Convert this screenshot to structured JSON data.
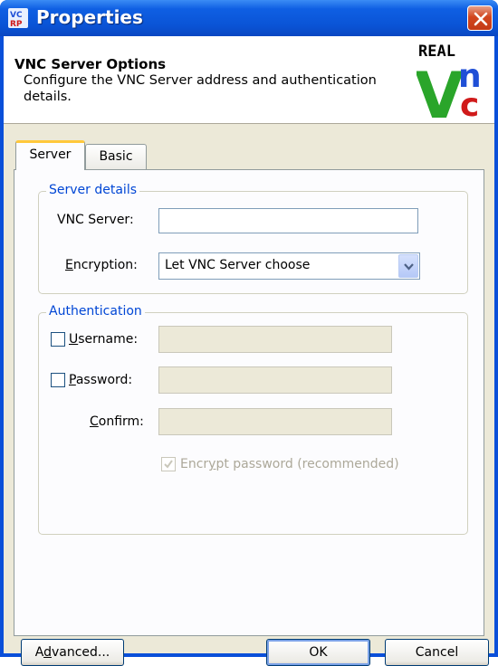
{
  "window": {
    "title": "Properties"
  },
  "header": {
    "title": "VNC Server Options",
    "description": "Configure the VNC Server address and authentication details.",
    "logo_text_top": "REAL",
    "logo_text_v": "V",
    "logo_text_n": "n",
    "logo_text_c": "c"
  },
  "tabs": [
    {
      "label": "Server",
      "active": true
    },
    {
      "label": "Basic",
      "active": false
    }
  ],
  "server_details": {
    "group_title": "Server details",
    "vnc_server_label": "VNC Server:",
    "vnc_server_value": "",
    "encryption_label_pre": "",
    "encryption_label_u": "E",
    "encryption_label_post": "ncryption:",
    "encryption_value": "Let VNC Server choose"
  },
  "authentication": {
    "group_title": "Authentication",
    "username_u": "U",
    "username_rest": "sername:",
    "username_checked": false,
    "username_value": "",
    "password_u": "P",
    "password_rest": "assword:",
    "password_checked": false,
    "password_value": "",
    "confirm_u": "C",
    "confirm_rest": "onfirm:",
    "confirm_value": "",
    "encrypt_pre": "Encr",
    "encrypt_u": "y",
    "encrypt_post": "pt password (recommended)",
    "encrypt_checked": true
  },
  "buttons": {
    "advanced_pre": "A",
    "advanced_u": "d",
    "advanced_post": "vanced...",
    "ok": "OK",
    "cancel": "Cancel"
  },
  "colors": {
    "titlebar": "#0a54d6",
    "group_title": "#0046d5",
    "logo_v": "#2aa52a",
    "logo_n": "#1f4fd6",
    "logo_c": "#d01a1a"
  }
}
